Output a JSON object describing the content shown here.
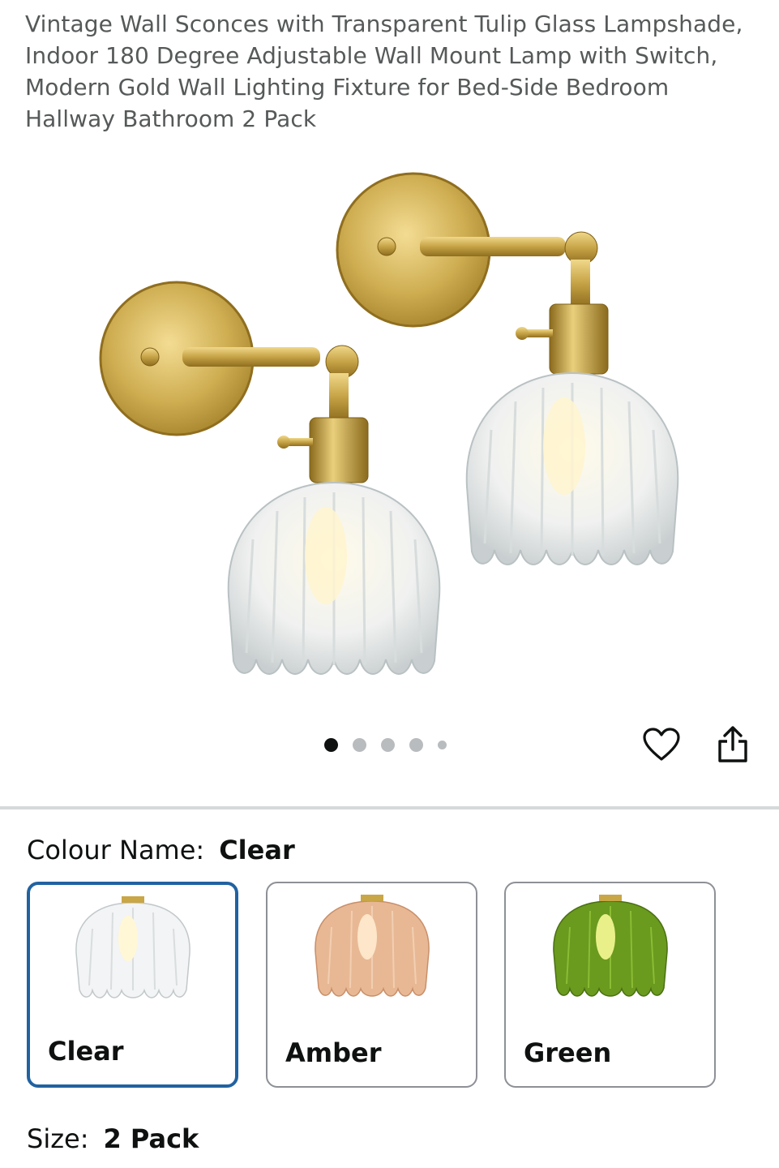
{
  "product": {
    "title": "Vintage Wall Sconces with Transparent Tulip Glass Lampshade, Indoor 180 Degree Adjustable Wall Mount Lamp with Switch, Modern Gold Wall Lighting Fixture for Bed-Side Bedroom Hallway Bathroom 2 Pack"
  },
  "gallery": {
    "image_count": 5,
    "active_index": 0,
    "wishlist_icon": "heart-icon",
    "share_icon": "share-icon"
  },
  "variants": {
    "colour_label": "Colour Name:",
    "colour_selected": "Clear",
    "options": [
      {
        "label": "Clear",
        "tint": "#f2f4f5",
        "selected": true
      },
      {
        "label": "Amber",
        "tint": "#e8b894",
        "selected": false
      },
      {
        "label": "Green",
        "tint": "#6a9a1e",
        "selected": false
      }
    ],
    "size_label": "Size:",
    "size_selected": "2 Pack"
  },
  "colors": {
    "selected_border": "#2162a1",
    "brass": "#c9a646"
  }
}
